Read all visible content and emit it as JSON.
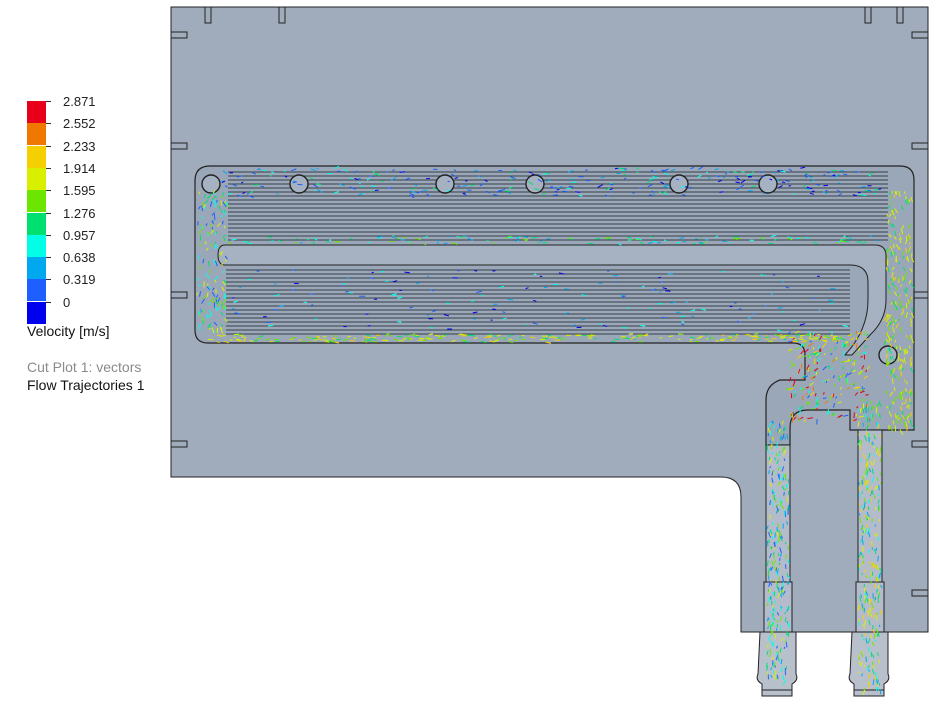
{
  "legend": {
    "title": "Velocity [m/s]",
    "plot_line1": "Cut Plot 1: vectors",
    "plot_line2": "Flow Trajectories 1",
    "ticks": [
      "2.871",
      "2.552",
      "2.233",
      "1.914",
      "1.595",
      "1.276",
      "0.957",
      "0.638",
      "0.319",
      "0"
    ],
    "colors": [
      "#e8001a",
      "#f07800",
      "#f5d000",
      "#d8f000",
      "#6ce600",
      "#00e070",
      "#00ffe6",
      "#00a8f0",
      "#1e60ff",
      "#0000ee"
    ]
  },
  "model": {
    "body_color": "#a0acbc",
    "outline_color": "#222222",
    "fin_color": "#3a3f48"
  }
}
